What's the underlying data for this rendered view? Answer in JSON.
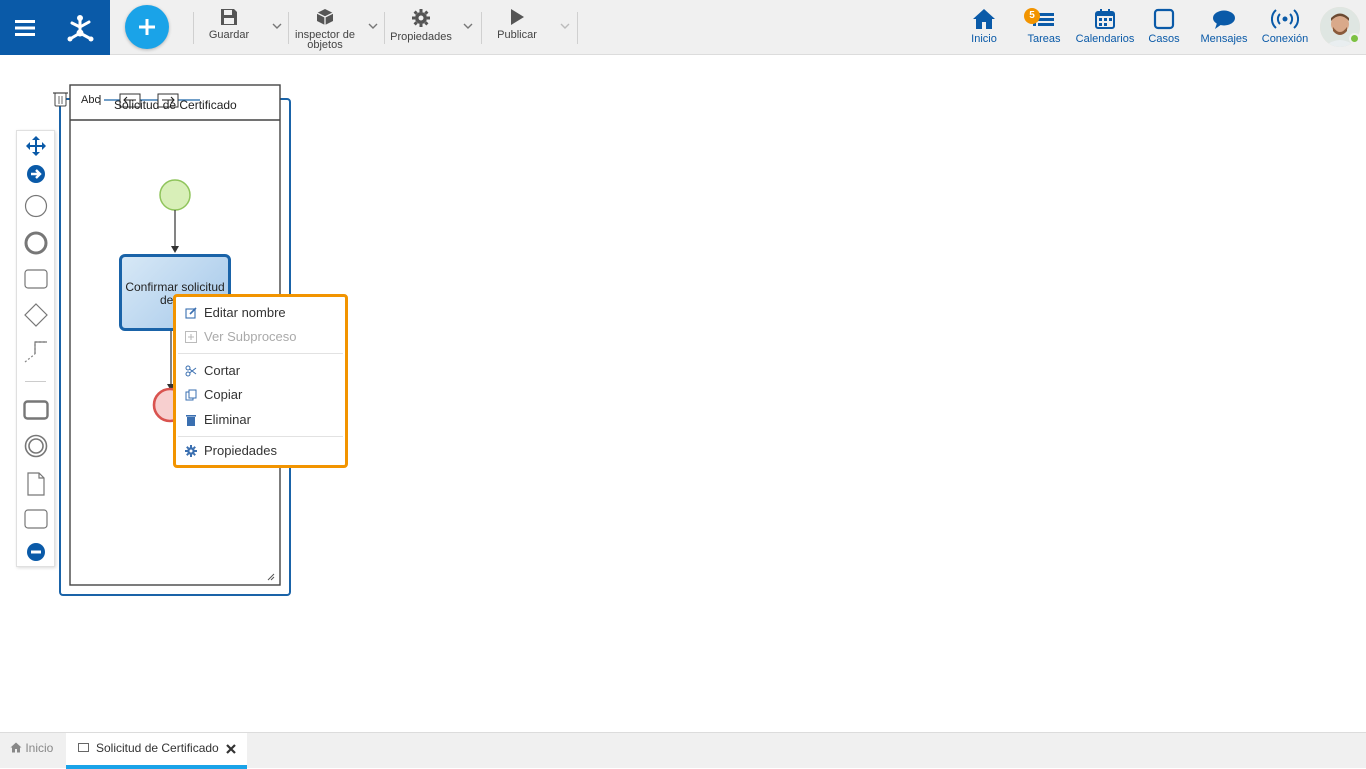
{
  "toolbar": {
    "save_label": "Guardar",
    "inspector_label": "inspector de objetos",
    "properties_label": "Propiedades",
    "publish_label": "Publicar"
  },
  "nav": {
    "home": "Inicio",
    "tasks": "Tareas",
    "tasks_count": "5",
    "calendars": "Calendarios",
    "cases": "Casos",
    "messages": "Mensajes",
    "connection": "Conexión"
  },
  "diagram": {
    "pool_title": "Solicitud de Certificado",
    "text_tool": "Abc",
    "task_label": "Confirmar solicitud de no"
  },
  "context_menu": {
    "edit_name": "Editar nombre",
    "view_subprocess": "Ver Subproceso",
    "cut": "Cortar",
    "copy": "Copiar",
    "delete": "Eliminar",
    "properties": "Propiedades"
  },
  "tabs": {
    "home": "Inicio",
    "document": "Solicitud de Certificado"
  },
  "colors": {
    "brand": "#0a5aa8",
    "accent": "#1aa3e8",
    "highlight": "#f29400"
  }
}
